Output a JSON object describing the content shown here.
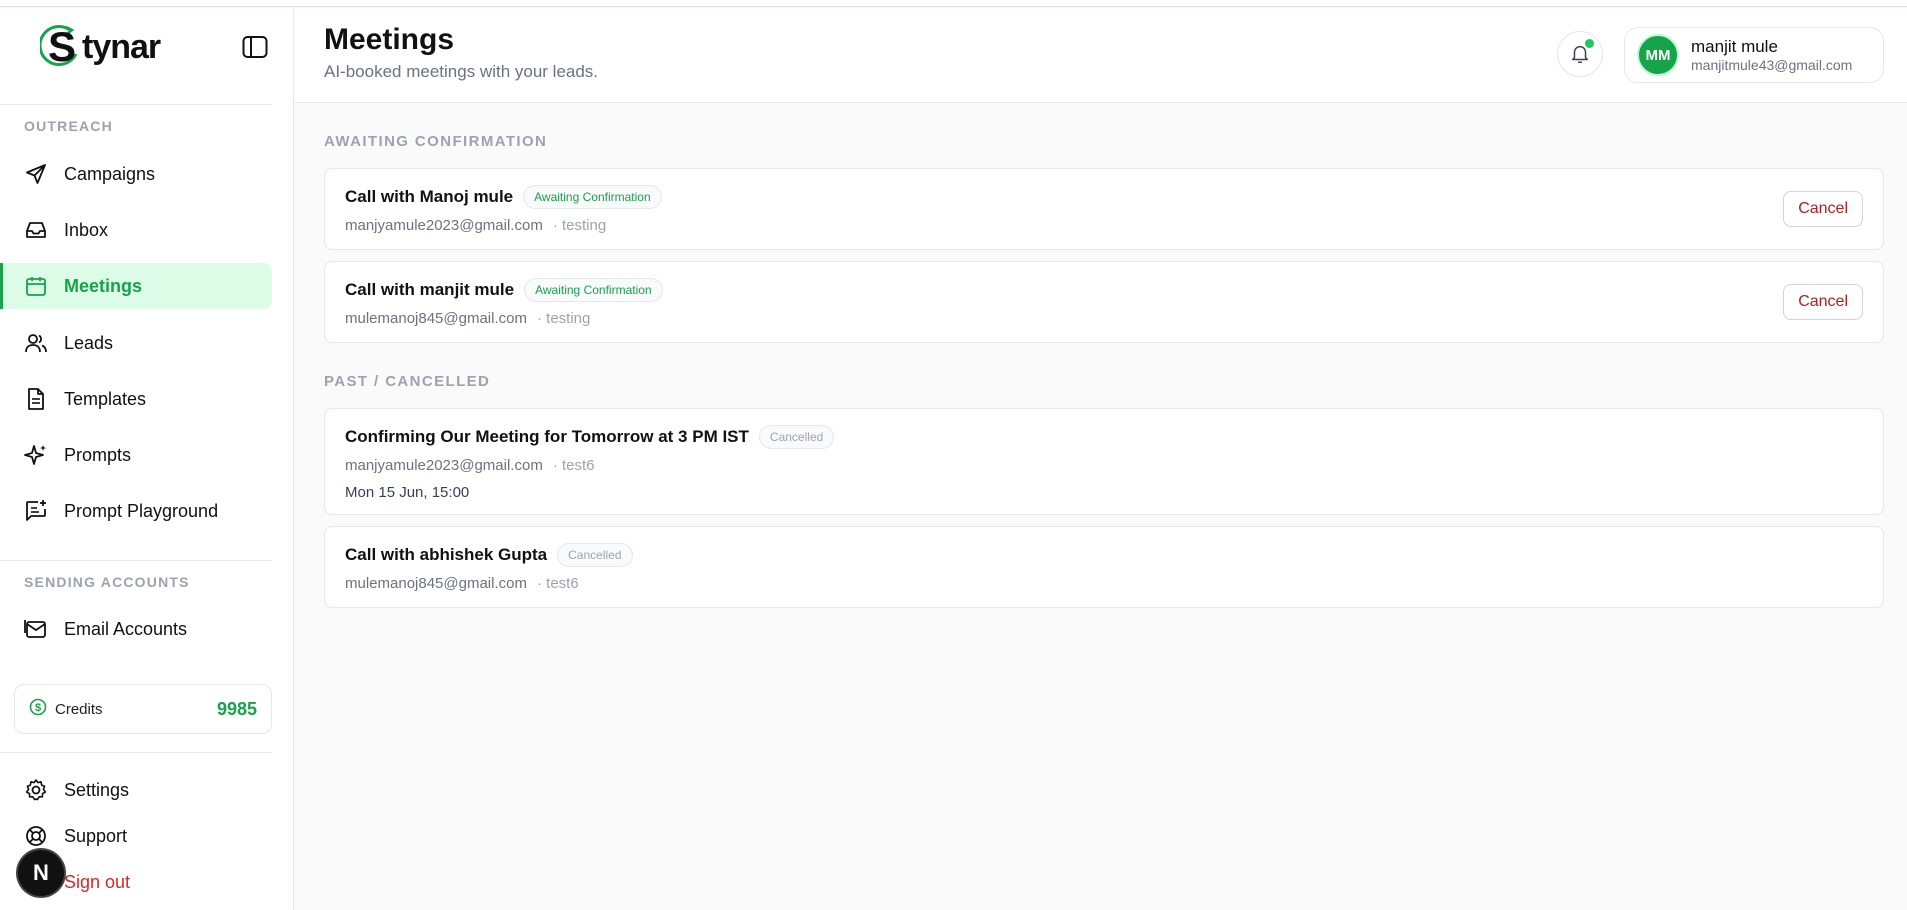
{
  "brand": {
    "logo_text": "tynar",
    "logo_initial": "S"
  },
  "sidebar": {
    "outreach_title": "OUTREACH",
    "outreach_items": [
      {
        "label": "Campaigns",
        "icon": "send-icon"
      },
      {
        "label": "Inbox",
        "icon": "inbox-icon"
      },
      {
        "label": "Meetings",
        "icon": "calendar-icon",
        "active": true
      },
      {
        "label": "Leads",
        "icon": "users-icon"
      },
      {
        "label": "Templates",
        "icon": "document-icon"
      },
      {
        "label": "Prompts",
        "icon": "sparkle-icon"
      },
      {
        "label": "Prompt Playground",
        "icon": "chat-plus-icon"
      }
    ],
    "sending_title": "SENDING ACCOUNTS",
    "sending_items": [
      {
        "label": "Email Accounts",
        "icon": "mail-icon"
      }
    ],
    "credits": {
      "label": "Credits",
      "value": "9985"
    },
    "footer_items": [
      {
        "label": "Settings",
        "icon": "gear-icon"
      },
      {
        "label": "Support",
        "icon": "lifebuoy-icon"
      },
      {
        "label": "Sign out",
        "icon": "logout-icon"
      }
    ],
    "n_badge": "N"
  },
  "header": {
    "title": "Meetings",
    "subtitle": "AI-booked meetings with your leads.",
    "user": {
      "initials": "MM",
      "name": "manjit mule",
      "email": "manjitmule43@gmail.com"
    }
  },
  "awaiting": {
    "title": "AWAITING CONFIRMATION",
    "items": [
      {
        "title": "Call with Manoj mule",
        "badge": "Awaiting Confirmation",
        "email": "manjyamule2023@gmail.com",
        "topic": "· testing",
        "action": "Cancel"
      },
      {
        "title": "Call with manjit mule",
        "badge": "Awaiting Confirmation",
        "email": "mulemanoj845@gmail.com",
        "topic": "· testing",
        "action": "Cancel"
      }
    ]
  },
  "past": {
    "title": "PAST / CANCELLED",
    "items": [
      {
        "title": "Confirming Our Meeting for Tomorrow at 3 PM IST",
        "badge": "Cancelled",
        "email": "manjyamule2023@gmail.com",
        "topic": "· test6",
        "time": "Mon 15 Jun, 15:00"
      },
      {
        "title": "Call with abhishek Gupta",
        "badge": "Cancelled",
        "email": "mulemanoj845@gmail.com",
        "topic": "· test6"
      }
    ]
  },
  "colors": {
    "accent": "#16a34a",
    "accent_bg": "#dcfce7",
    "danger": "#dc2626"
  }
}
